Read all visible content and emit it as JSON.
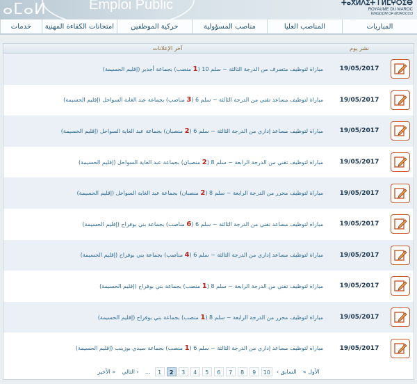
{
  "banner": {
    "logo_text": "ⴰⵎⴰⵍ",
    "portal_text": "Emploi Public",
    "kingdom_line1": "ⵜⴰⴳⵍⴷⵉⵜ ⵏ ⵍⵎⵖⵔⵉⴱ",
    "kingdom_line2": "ROYAUME DU MAROC",
    "kingdom_line3": "KINGDOM OF MOROCCO"
  },
  "nav": {
    "tabs": [
      "المباريات",
      "المناصب العليا",
      "مناصب المسؤولية",
      "حركية الموظفين",
      "امتحانات الكفاءة المهنية",
      "خدمات"
    ]
  },
  "table": {
    "col_date": "نشر يوم",
    "col_title": "آخر الإعلانات",
    "rows": [
      {
        "date": "19/05/2017",
        "pre": "مباراة لتوظيف متصرف من الدرجة الثالثة ~ سلم 10 (",
        "num": "1",
        "post": " منصب) بجماعة أجدير (إقليم الحسيمة)"
      },
      {
        "date": "19/05/2017",
        "pre": "مباراة لتوظيف مساعد تقني من الدرجة الثالثة ~ سلم 6 (",
        "num": "3",
        "post": " مناصب) بجماعة عبد الغاية السواحل (إقليم الحسيمة)"
      },
      {
        "date": "19/05/2017",
        "pre": "مباراة لتوظيف مساعد إداري من الدرجة الثالثة ~ سلم 6 (",
        "num": "2",
        "post": " منصبان) بجماعة عبد الغاية السواحل (إقليم الحسيمة)"
      },
      {
        "date": "19/05/2017",
        "pre": "مباراة لتوظيف تقني من الدرجة الرابعة ~ سلم 8 (",
        "num": "2",
        "post": " منصبان) بجماعة عبد الغاية السواحل (إقليم الحسيمة)"
      },
      {
        "date": "19/05/2017",
        "pre": "مباراة لتوظيف محرر من الدرجة الرابعة ~ سلم 8 (",
        "num": "2",
        "post": " منصبان) بجماعة عبد الغاية السواحل (إقليم الحسيمة)"
      },
      {
        "date": "19/05/2017",
        "pre": "مباراة لتوظيف مساعد تقني من الدرجة الثالثة ~ سلم 6 (",
        "num": "6",
        "post": " مناصب) بجماعة بني بوفراح (إقليم الحسيمة)"
      },
      {
        "date": "19/05/2017",
        "pre": "مباراة لتوظيف مساعد إداري من الدرجة الثالثة ~ سلم 6 (",
        "num": "4",
        "post": " مناصب) بجماعة بني بوفراح (إقليم الحسيمة)"
      },
      {
        "date": "19/05/2017",
        "pre": "مباراة لتوظيف تقني من الدرجة الرابعة ~ سلم 8 (",
        "num": "1",
        "post": " منصب) بجماعة بني بوفراح (إقليم الحسيمة)"
      },
      {
        "date": "19/05/2017",
        "pre": "مباراة لتوظيف محرر من الدرجة الرابعة ~ سلم 8 (",
        "num": "1",
        "post": " منصب) بجماعة بني بوفراح (إقليم الحسيمة)"
      },
      {
        "date": "19/05/2017",
        "pre": "مباراة لتوظيف مساعد إداري من الدرجة الثالثة ~ سلم 6 (",
        "num": "1",
        "post": " منصب) بجماعة سيدي بوزينب (إقليم الحسيمة)"
      }
    ]
  },
  "pager": {
    "first": "« الأول",
    "prev": "‹ السابق",
    "pages": [
      "1",
      "2",
      "3",
      "4",
      "5",
      "6",
      "7",
      "8",
      "9",
      "10"
    ],
    "current": "2",
    "ellipsis": "…",
    "next": "التالي ›",
    "last": "الأخير »"
  },
  "colors": {
    "accent": "#c8572b",
    "link": "#2d6b96",
    "highlight_number": "#b5241a"
  }
}
